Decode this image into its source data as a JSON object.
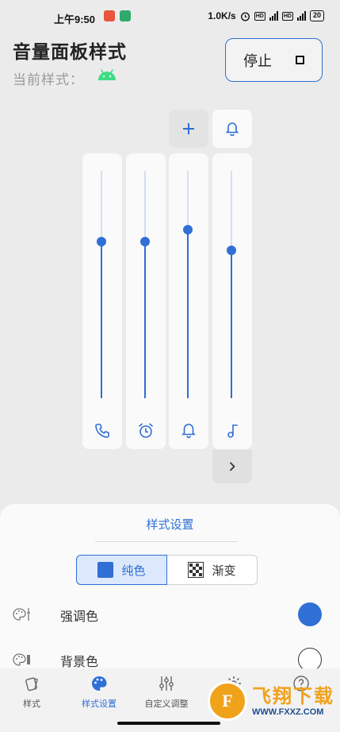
{
  "status_bar": {
    "time": "上午9:50",
    "speed": "1.0K/s",
    "battery": "20",
    "hd": "HD"
  },
  "header": {
    "title": "音量面板样式",
    "subtitle": "当前样式：",
    "current_style_icon": "android-icon",
    "stop_label": "停止"
  },
  "controls": {
    "add_icon": "plus-icon",
    "ringer_icon": "bell-icon",
    "more_icon": "chevron-right-icon"
  },
  "sliders": [
    {
      "name": "call",
      "icon": "phone-icon",
      "level": 0.69
    },
    {
      "name": "alarm",
      "icon": "alarm-clock-icon",
      "level": 0.69
    },
    {
      "name": "ring",
      "icon": "bell-icon",
      "level": 0.74
    },
    {
      "name": "media",
      "icon": "music-note-icon",
      "level": 0.65
    }
  ],
  "style_panel": {
    "title": "样式设置",
    "segments": [
      "纯色",
      "渐变"
    ],
    "selected_segment": "纯色",
    "rows": [
      {
        "label": "强调色",
        "icon": "palette-icon",
        "color": "#2f6fd6"
      },
      {
        "label": "背景色",
        "icon": "palette-icon",
        "color": "#ffffff"
      }
    ]
  },
  "bottom_nav": {
    "items": [
      {
        "label": "样式",
        "icon": "cards-icon"
      },
      {
        "label": "样式设置",
        "icon": "palette-icon"
      },
      {
        "label": "自定义调整",
        "icon": "sliders-icon"
      },
      {
        "label": "",
        "icon": "gear-icon"
      },
      {
        "label": "",
        "icon": "help-icon"
      }
    ],
    "active": "样式设置"
  },
  "watermark": {
    "name": "飞翔下载",
    "url": "WWW.FXXZ.COM",
    "logo_letter": "F"
  },
  "colors": {
    "accent": "#2f6fd6",
    "background": "#ebebeb",
    "panel": "#fafafa"
  }
}
